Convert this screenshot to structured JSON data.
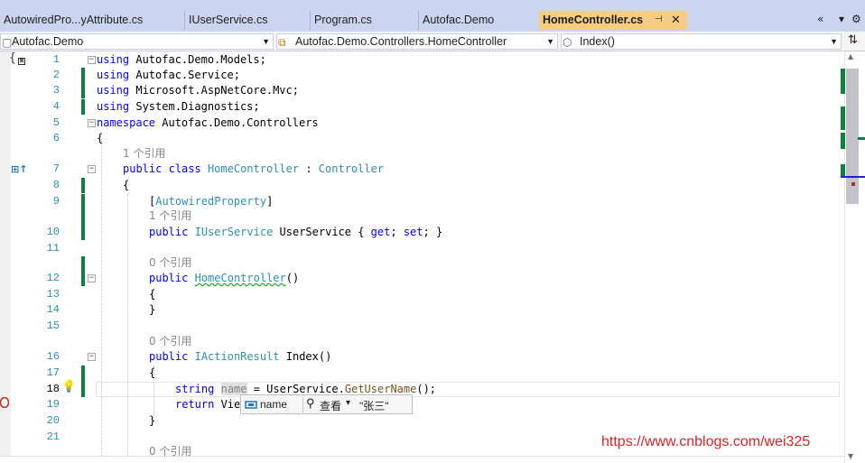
{
  "tabs": [
    {
      "label": "AutowiredPro...yAttribute.cs",
      "active": false
    },
    {
      "label": "IUserService.cs",
      "active": false
    },
    {
      "label": "Program.cs",
      "active": false
    },
    {
      "label": "Autofac.Demo",
      "active": false
    },
    {
      "label": "HomeController.cs",
      "active": true
    }
  ],
  "tab_controls": {
    "pin": "⊣",
    "close": "✕",
    "overflow": "«",
    "dropdown": "▾",
    "settings": "⚙"
  },
  "nav": {
    "project": "Autofac.Demo",
    "type": "Autofac.Demo.Controllers.HomeController",
    "member": "Index()",
    "split": "⇅"
  },
  "code": {
    "lines": [
      "1",
      "2",
      "3",
      "4",
      "5",
      "6",
      "7",
      "8",
      "9",
      "10",
      "11",
      "12",
      "13",
      "14",
      "15",
      "16",
      "17",
      "18",
      "19",
      "20",
      "21"
    ],
    "l1_kw": "using",
    "l1_rest": " Autofac.Demo.Models;",
    "l2_kw": "using",
    "l2_rest": " Autofac.Service;",
    "l3_kw": "using",
    "l3_rest": " Microsoft.AspNetCore.Mvc;",
    "l4_kw": "using",
    "l4_rest": " System.Diagnostics;",
    "l5_kw": "namespace",
    "l5_rest": " Autofac.Demo.Controllers",
    "l6": "{",
    "lens_class": "1 个引用",
    "l7_kw1": "public",
    "l7_kw2": "class",
    "l7_name": "HomeController",
    "l7_colon": " : ",
    "l7_base": "Controller",
    "l8": "{",
    "l9_open": "[",
    "l9_attr": "AutowiredProperty",
    "l9_close": "]",
    "lens_prop": "1 个引用",
    "l10_kw": "public",
    "l10_type": "IUserService",
    "l10_name": " UserService { ",
    "l10_get": "get",
    "l10_semi": "; ",
    "l10_set": "set",
    "l10_end": "; }",
    "lens_ctor": "0 个引用",
    "l12_kw": "public",
    "l12_name": "HomeController",
    "l12_parens": "()",
    "l13": "{",
    "l14": "}",
    "lens_index": "0 个引用",
    "l16_kw": "public",
    "l16_type": "IActionResult",
    "l16_name": " Index()",
    "l17": "{",
    "l18_kw": "string",
    "l18_var": "name",
    "l18_mid": " = UserService.",
    "l18_method": "GetUserName",
    "l18_end": "();",
    "l19_kw": "return",
    "l19_rest": " Vie",
    "l20": "}",
    "lens_next": "0 个引用"
  },
  "quickinfo": {
    "name": "name",
    "view": "查看",
    "dropdown": "▾",
    "value": "\"张三\""
  },
  "watermark": "https://www.cnblogs.com/wei325"
}
